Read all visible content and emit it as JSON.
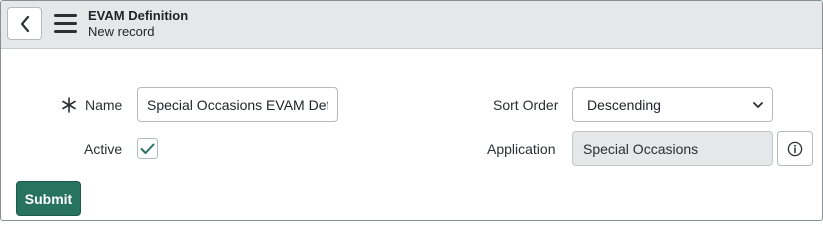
{
  "header": {
    "title": "EVAM Definition",
    "subtitle": "New record",
    "back_icon": "chevron-left-icon",
    "menu_icon": "hamburger-menu-icon"
  },
  "form": {
    "name": {
      "label": "Name",
      "required": true,
      "value": "Special Occasions EVAM Def"
    },
    "active": {
      "label": "Active",
      "checked": true
    },
    "sort_order": {
      "label": "Sort Order",
      "selected": "Descending"
    },
    "application": {
      "label": "Application",
      "value": "Special Occasions",
      "info_icon": "info-icon"
    }
  },
  "actions": {
    "submit_label": "Submit"
  },
  "colors": {
    "header_bg": "#e6e7e9",
    "primary": "#27735f",
    "check": "#27735f",
    "readonly_bg": "#e6e7e9"
  }
}
